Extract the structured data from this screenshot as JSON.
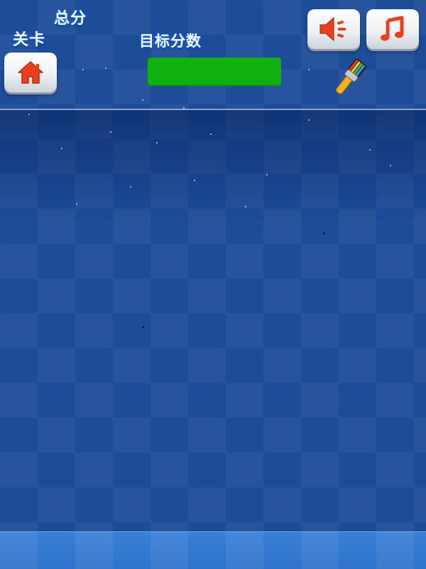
{
  "hud": {
    "total_score_label": "总分",
    "level_label": "关卡",
    "target_score_label": "目标分数"
  },
  "buttons": {
    "home": {
      "icon": "home-icon"
    },
    "sound": {
      "icon": "speaker-icon"
    },
    "music": {
      "icon": "music-note-icon"
    },
    "paint": {
      "icon": "paintbrush-icon"
    }
  },
  "colors": {
    "board": "#1d4c98",
    "target_bar": "#0fb00f",
    "icon_accent": "#e8401c",
    "bottom_strip": "#3a7fd6"
  }
}
